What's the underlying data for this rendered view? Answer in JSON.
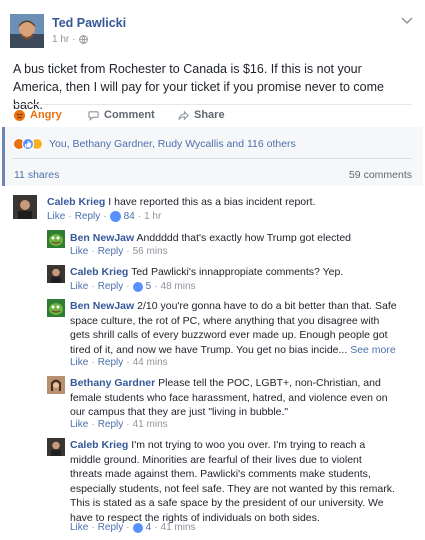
{
  "post": {
    "author": "Ted Pawlicki",
    "time": "1 hr",
    "privacy_icon": "globe-icon",
    "text": "A bus ticket from Rochester to Canada is $16. If this is not your America, then I will pay for your ticket if you promise never to come back."
  },
  "actions": {
    "reaction_label": "Angry",
    "comment_label": "Comment",
    "share_label": "Share"
  },
  "reactions_summary": "You, Bethany Gardner, Rudy Wycallis and 116 others",
  "counts": {
    "shares": "11 shares",
    "comments": "59 comments"
  },
  "colors": {
    "link_blue": "#365899",
    "angry_orange": "#e9710f",
    "like_blue": "#5890ff"
  },
  "comments": [
    {
      "author": "Caleb Krieg",
      "text": "I have reported this as a bias incident report.",
      "like": "Like",
      "reply": "Reply",
      "reactions": "84",
      "time": "1 hr"
    }
  ],
  "replies": [
    {
      "author": "Ben NewJaw",
      "text": "Anddddd that's exactly how Trump got elected",
      "like": "Like",
      "reply": "Reply",
      "time": "56 mins"
    },
    {
      "author": "Caleb Krieg",
      "text": "Ted Pawlicki's innappropiate comments? Yep.",
      "like": "Like",
      "reply": "Reply",
      "reactions": "5",
      "time": "48 mins"
    },
    {
      "author": "Ben NewJaw",
      "text": "2/10 you're gonna have to do a bit better than that. Safe space culture, the rot of PC, where anything that you disagree with gets shrill calls of every buzzword ever made up. Enough people got tired of it, and now we have Trump. You get no bias incide...",
      "see_more": "See more",
      "like": "Like",
      "reply": "Reply",
      "time": "44 mins"
    },
    {
      "author": "Bethany Gardner",
      "text": "Please tell the POC, LGBT+, non-Christian, and female students who face harassment, hatred, and violence even on our campus that they are just \"living in bubble.\"",
      "like": "Like",
      "reply": "Reply",
      "time": "41 mins"
    },
    {
      "author": "Caleb Krieg",
      "text": "I'm not trying to woo you over. I'm trying to reach a middle ground. Minorities are fearful of their lives due to violent threats made against them. Pawlicki's comments make students, especially students, not feel safe. They are not wanted by this remark. This is stated as a safe space by the president of our university. We have to respect the rights of individuals on both sides.",
      "like": "Like",
      "reply": "Reply",
      "reactions": "4",
      "time": "41 mins"
    }
  ]
}
